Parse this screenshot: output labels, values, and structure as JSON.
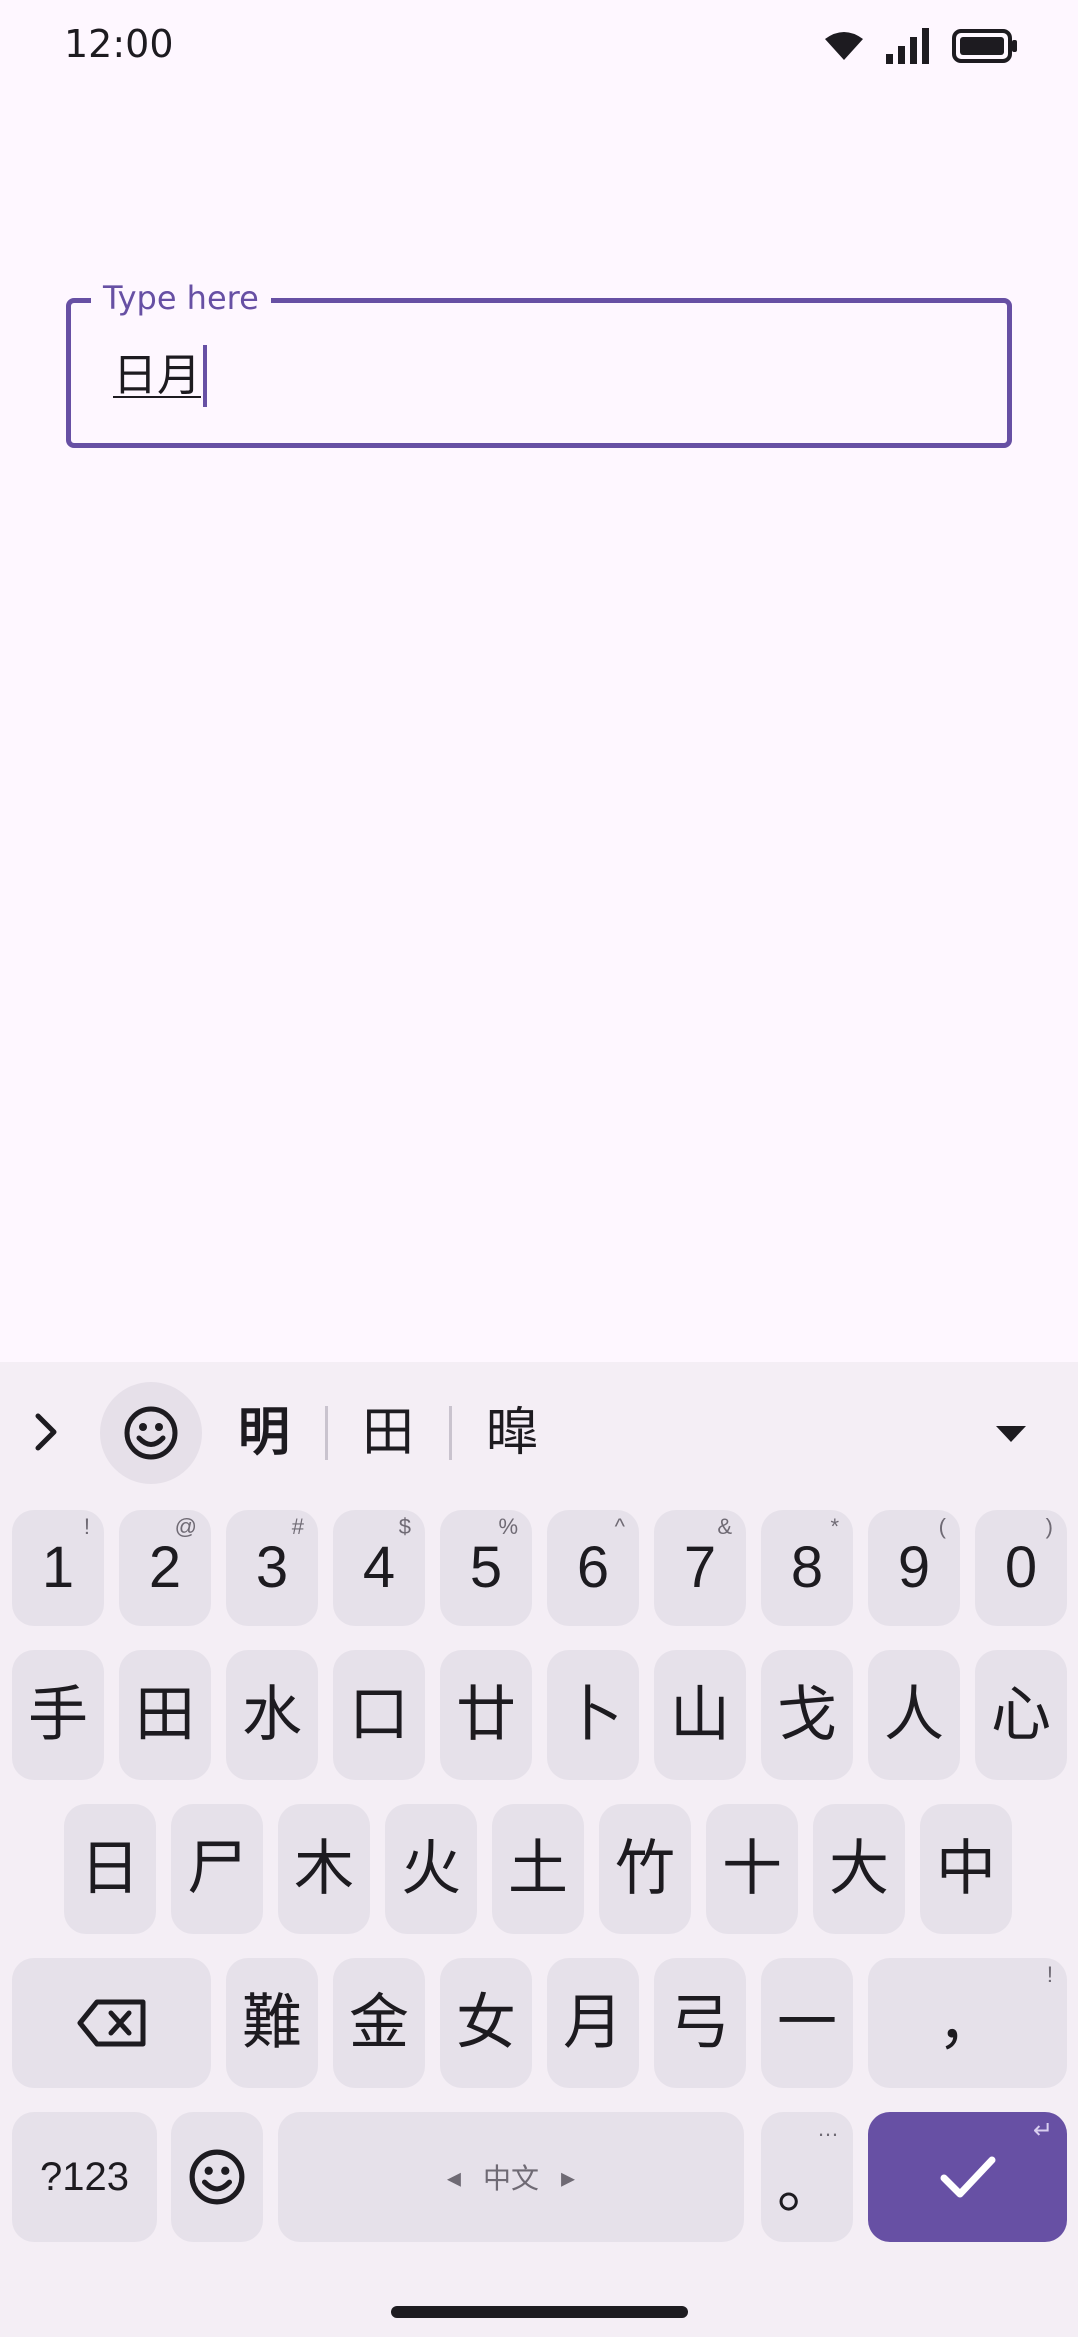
{
  "status_bar": {
    "time": "12:00",
    "icons": [
      "wifi-icon",
      "cellular-signal-icon",
      "battery-icon"
    ]
  },
  "text_field": {
    "label": "Type here",
    "value": "日月",
    "accent_color": "#6750A4"
  },
  "keyboard": {
    "candidates": [
      "明",
      "田",
      "暭"
    ],
    "number_row": [
      {
        "key": "1",
        "hint": "!"
      },
      {
        "key": "2",
        "hint": "@"
      },
      {
        "key": "3",
        "hint": "#"
      },
      {
        "key": "4",
        "hint": "$"
      },
      {
        "key": "5",
        "hint": "%"
      },
      {
        "key": "6",
        "hint": "^"
      },
      {
        "key": "7",
        "hint": "&"
      },
      {
        "key": "8",
        "hint": "*"
      },
      {
        "key": "9",
        "hint": "("
      },
      {
        "key": "0",
        "hint": ")"
      }
    ],
    "row1": [
      "手",
      "田",
      "水",
      "口",
      "廿",
      "卜",
      "山",
      "戈",
      "人",
      "心"
    ],
    "row2": [
      "日",
      "尸",
      "木",
      "火",
      "土",
      "竹",
      "十",
      "大",
      "中"
    ],
    "row3": [
      "難",
      "金",
      "女",
      "月",
      "弓",
      "一"
    ],
    "comma_key": {
      "key": "，",
      "hint": "!"
    },
    "symbols_key": "?123",
    "space_label": "中文",
    "period_key": {
      "key": "。",
      "hint": "…"
    },
    "enter_hint": "↵",
    "action_color": "#6750A4"
  }
}
